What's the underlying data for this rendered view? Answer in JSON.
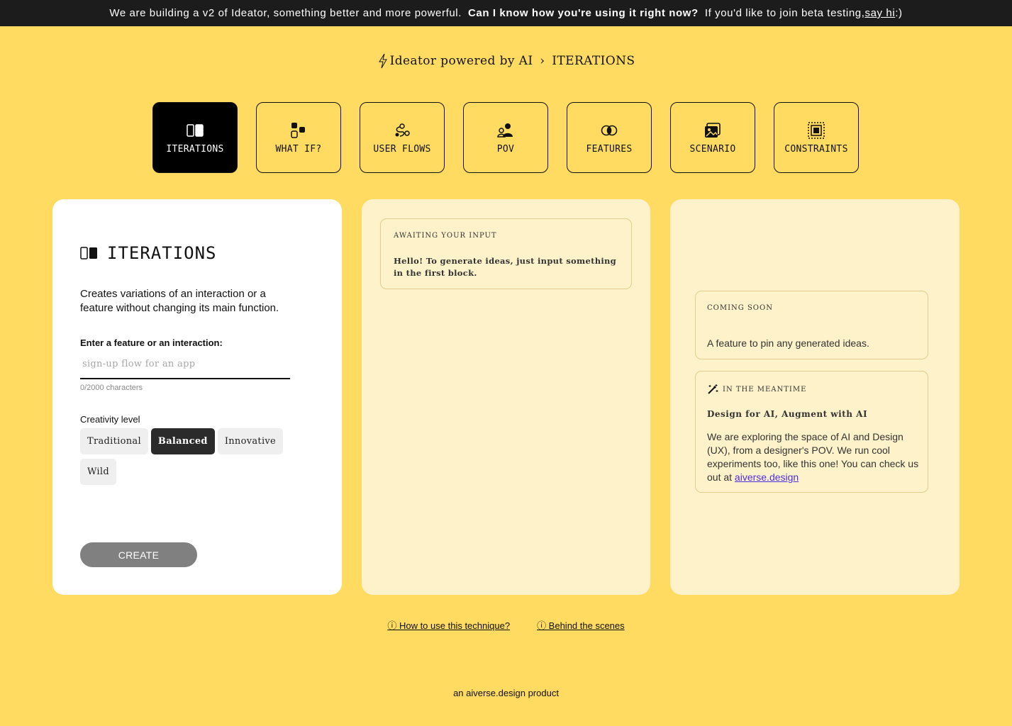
{
  "banner": {
    "text1": "We are building a v2 of Ideator, something better and more powerful.",
    "bold": "Can I know how you're using it right now?",
    "text2": "If you'd like to join beta testing,",
    "link": "say hi",
    "tail": ":)"
  },
  "header": {
    "app": "Ideator powered by AI",
    "separator": "›",
    "current": "ITERATIONS"
  },
  "tabs": [
    {
      "label": "ITERATIONS",
      "icon": "iterations-icon",
      "active": true
    },
    {
      "label": "WHAT IF?",
      "icon": "what-if-icon"
    },
    {
      "label": "USER FLOWS",
      "icon": "user-flows-icon"
    },
    {
      "label": "POV",
      "icon": "pov-icon"
    },
    {
      "label": "FEATURES",
      "icon": "features-icon"
    },
    {
      "label": "SCENARIO",
      "icon": "scenario-icon"
    },
    {
      "label": "CONSTRAINTS",
      "icon": "constraints-icon"
    }
  ],
  "input_panel": {
    "title": "ITERATIONS",
    "description": "Creates variations of an interaction or a feature without changing its main function.",
    "field_label": "Enter a feature or an interaction:",
    "field_value": "",
    "field_placeholder": "sign-up flow for an app",
    "counter": "0/2000 characters",
    "creativity_label": "Creativity level",
    "levels": [
      "Traditional",
      "Balanced",
      "Innovative",
      "Wild"
    ],
    "selected_level": "Balanced",
    "create_label": "CREATE"
  },
  "output_panel": {
    "caption": "AWAITING YOUR INPUT",
    "message": "Hello! To generate ideas, just input something in the first block."
  },
  "side_panel": {
    "soon_caption": "COMING SOON",
    "soon_text": "A feature to pin any generated ideas.",
    "meantime_caption": "IN THE MEANTIME",
    "meantime_heading": "Design for AI, Augment with AI",
    "meantime_body": "We are exploring the space of AI and Design (UX), from a designer's POV. We run cool experiments too, like this one! You can check us out at",
    "meantime_link": "aiverse.design"
  },
  "links": {
    "how": "ⓘ How to use this technique?",
    "behind": "ⓘ Behind the scenes"
  },
  "footer": "an aiverse.design product"
}
